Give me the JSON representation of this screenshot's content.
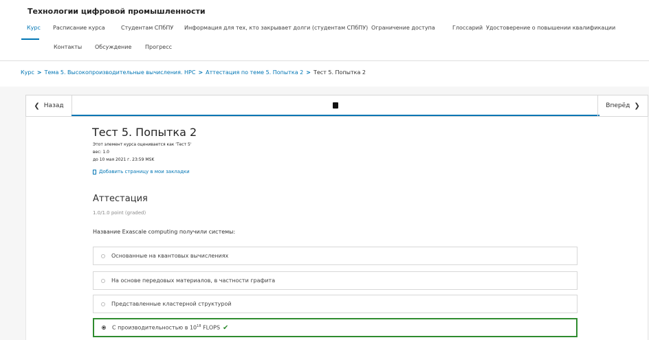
{
  "course": {
    "title": "Технологии цифровой промышленности"
  },
  "tabs": [
    {
      "label": "Курс",
      "active": true
    },
    {
      "label": "Расписание курса"
    },
    {
      "label": "Студентам СПбПУ"
    },
    {
      "label": "Информация для тех, кто закрывает долги (студентам СПбПУ)"
    },
    {
      "label": "Ограничение доступа"
    },
    {
      "label": "Глоссарий"
    },
    {
      "label": "Удостоверение о повышении квалификации"
    },
    {
      "label": "Контакты"
    },
    {
      "label": "Обсуждение"
    },
    {
      "label": "Прогресс"
    }
  ],
  "breadcrumbs": {
    "items": [
      "Курс",
      "Тема 5. Высокопроизводительные вычисления. HPC",
      "Аттестация по теме 5. Попытка 2"
    ],
    "current": "Тест 5. Попытка 2",
    "separator": ">"
  },
  "nav": {
    "prev": "Назад",
    "next": "Вперёд",
    "prev_icon": "chevron-left-icon",
    "next_icon": "chevron-right-icon",
    "unit_icon": "book-icon"
  },
  "unit": {
    "title": "Тест 5. Попытка 2",
    "graded_as": "Этот элемент курса оценивается как 'Тест 5'",
    "weight": "вес: 1.0",
    "due": "до 10 мая 2021 г. 23:59 MSK",
    "bookmark": "Добавить страницу в мои закладки"
  },
  "problem": {
    "title": "Аттестация",
    "points": "1.0/1.0 point (graded)",
    "question": "Название Exascale computing получили системы:",
    "choices": [
      {
        "label": "Основанные на квантовых вычислениях"
      },
      {
        "label": "На основе передовых материалов, в частности графита"
      },
      {
        "label": "Представленные кластерной структурой"
      },
      {
        "label_prefix": "С производительностью в 10",
        "label_sup": "18",
        "label_suffix": " FLOPS",
        "selected": true,
        "correct": true
      }
    ]
  },
  "colors": {
    "accent": "#0075b4",
    "correct": "#2e8b2e"
  }
}
